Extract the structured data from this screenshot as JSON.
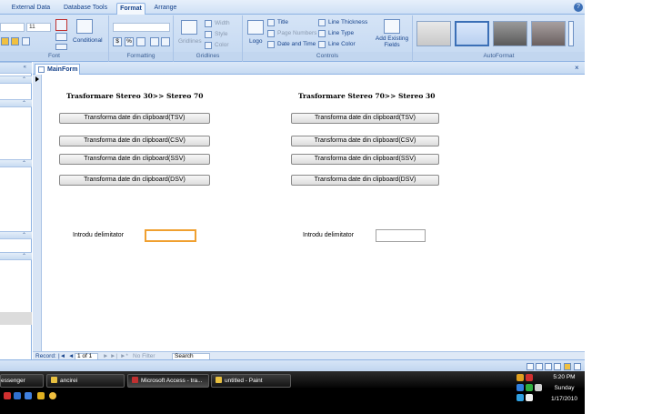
{
  "ribbon": {
    "tabs": [
      {
        "label": "External Data",
        "active": false
      },
      {
        "label": "Database Tools",
        "active": false
      },
      {
        "label": "Format",
        "active": true
      },
      {
        "label": "Arrange",
        "active": false
      }
    ],
    "font_group": {
      "label": "Font",
      "font_size": "11",
      "conditional_label": "Conditional"
    },
    "formatting_group": {
      "label": "Formatting",
      "currency_symbol": "$",
      "percent_symbol": "%"
    },
    "gridlines_group": {
      "label": "Gridlines",
      "gridlines_label": "Gridlines",
      "width_label": "Width",
      "style_label": "Style",
      "color_label": "Color"
    },
    "controls_group": {
      "label": "Controls",
      "logo_label": "Logo",
      "title_label": "Title",
      "page_numbers_label": "Page Numbers",
      "date_time_label": "Date and Time",
      "line_thickness_label": "Line Thickness",
      "line_type_label": "Line Type",
      "line_color_label": "Line Color",
      "add_fields_label": "Add Existing Fields"
    },
    "autoformat_group": {
      "label": "AutoFormat"
    },
    "help_symbol": "?"
  },
  "form": {
    "tab_label": "MainForm",
    "close_symbol": "×",
    "left_heading": "Trasformare Stereo 30>> Stereo 70",
    "right_heading": "Trasformare Stereo 70>> Stereo 30",
    "left_buttons": [
      "Transforma date din clipboard(TSV)",
      "Transforma date din clipboard(CSV)",
      "Transforma date din clipboard(SSV)",
      "Transforma date din clipboard(DSV)"
    ],
    "right_buttons": [
      "Transforma date din clipboard(TSV)",
      "Transforma date din clipboard(CSV)",
      "Transforma date din clipboard(SSV)",
      "Transforma date din clipboard(DSV)"
    ],
    "left_delimiter_label": "Introdu delimitator",
    "right_delimiter_label": "Introdu delimitator",
    "left_delimiter_value": "",
    "right_delimiter_value": ""
  },
  "record_nav": {
    "record_label": "Record:",
    "first_symbol": "|◄",
    "prev_symbol": "◄",
    "position": "1 of 1",
    "next_symbol": "►",
    "last_symbol": "►|",
    "new_symbol": "►*",
    "filter_label": "No Filter",
    "search_label": "Search"
  },
  "taskbar": {
    "buttons": [
      {
        "label": "essenger",
        "active": false,
        "color": "#3a8ad8"
      },
      {
        "label": "ancirei",
        "active": false,
        "color": "#e8c040"
      },
      {
        "label": "Microsoft Access - tra...",
        "active": true,
        "color": "#c03030"
      },
      {
        "label": "untitled - Paint",
        "active": false,
        "color": "#e8c040"
      }
    ],
    "clock_time": "5:20 PM",
    "clock_day": "Sunday",
    "clock_date": "1/17/2010"
  },
  "colors": {
    "accent": "#15428b",
    "ribbon_bg": "#c4d8f1",
    "focus_border": "#f0a030"
  }
}
